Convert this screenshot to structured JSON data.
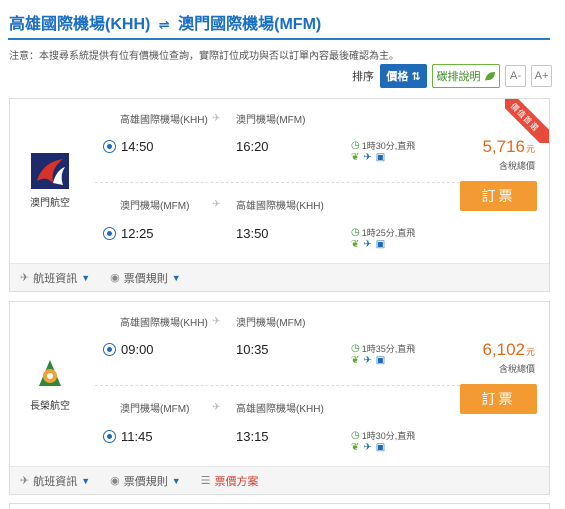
{
  "header": {
    "from_airport": "高雄國際機場(KHH)",
    "swap_symbol": "⇌",
    "to_airport": "澳門國際機場(MFM)"
  },
  "notice": "注意：本搜尋系統提供有位有價機位查詢，實際訂位成功與否以訂單內容最後確認為主。",
  "sort": {
    "label": "排序",
    "price_label": "價格",
    "eco_label": "碳排說明",
    "font_smaller": "A-",
    "font_larger": "A+"
  },
  "flights": [
    {
      "airline": "澳門航空",
      "badge": "價值首選",
      "price": "5,716",
      "price_unit": "元",
      "tax_note": "含稅總價",
      "book_label": "訂票",
      "segments": [
        {
          "dep_airport": "高雄國際機場(KHH)",
          "arr_airport": "澳門機場(MFM)",
          "dep_time": "14:50",
          "arr_time": "16:20",
          "duration": "1時30分,直飛"
        },
        {
          "dep_airport": "澳門機場(MFM)",
          "arr_airport": "高雄國際機場(KHH)",
          "dep_time": "12:25",
          "arr_time": "13:50",
          "duration": "1時25分,直飛"
        }
      ],
      "footer": {
        "flight_info": "航班資訊",
        "fare_rules": "票價規則"
      }
    },
    {
      "airline": "長榮航空",
      "price": "6,102",
      "price_unit": "元",
      "tax_note": "含稅總價",
      "book_label": "訂票",
      "segments": [
        {
          "dep_airport": "高雄國際機場(KHH)",
          "arr_airport": "澳門機場(MFM)",
          "dep_time": "09:00",
          "arr_time": "10:35",
          "duration": "1時35分,直飛"
        },
        {
          "dep_airport": "澳門機場(MFM)",
          "arr_airport": "高雄國際機場(KHH)",
          "dep_time": "11:45",
          "arr_time": "13:15",
          "duration": "1時30分,直飛"
        }
      ],
      "footer": {
        "flight_info": "航班資訊",
        "fare_rules": "票價規則",
        "fare_plans": "票價方案"
      }
    }
  ],
  "icons": {
    "plane_gray": "plane-icon",
    "clock": "clock-icon",
    "leaf": "leaf-icon",
    "bag": "baggage-icon",
    "sort": "sort-icon"
  },
  "colors": {
    "brand_blue": "#1f6bb8",
    "price_orange": "#e26b1a",
    "book_orange": "#f39a33",
    "eco_green": "#3a8a1f",
    "ribbon_red": "#e64b3c"
  }
}
